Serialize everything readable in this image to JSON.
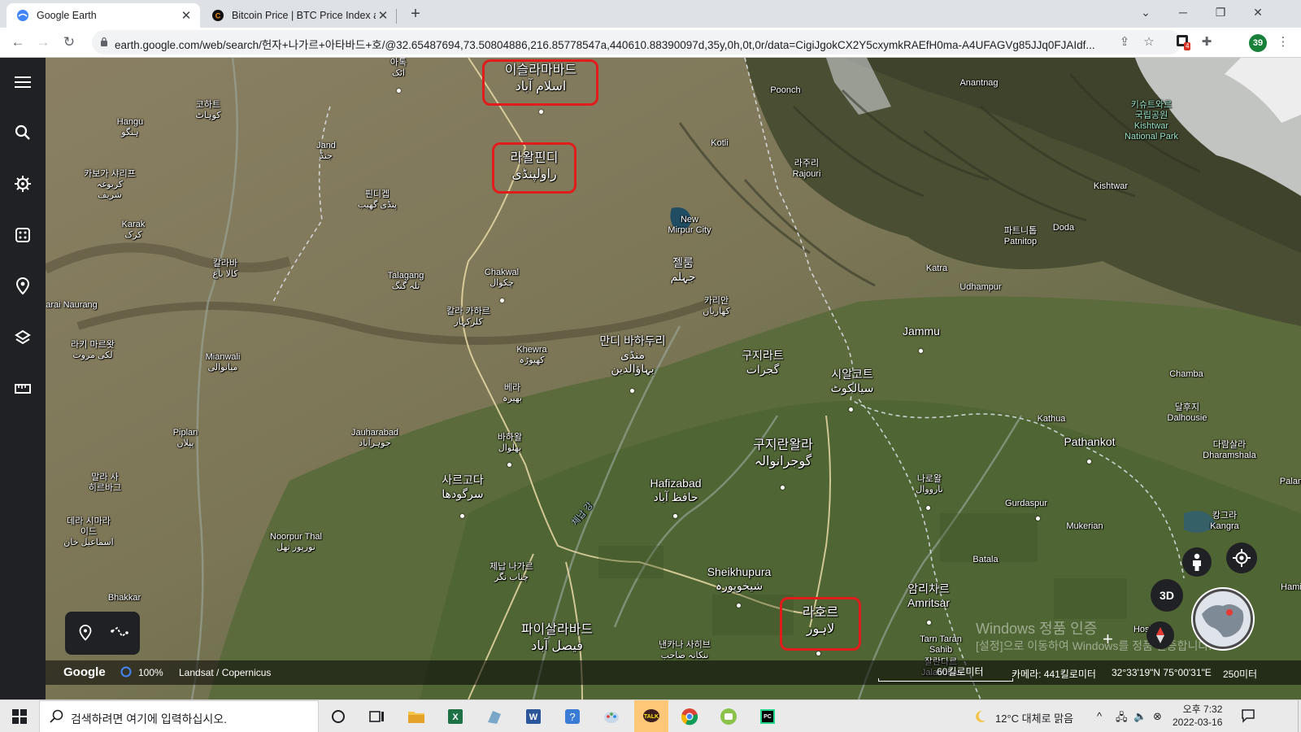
{
  "browser": {
    "tabs": [
      {
        "title": "Google Earth",
        "active": true
      },
      {
        "title": "Bitcoin Price | BTC Price Index a",
        "active": false
      }
    ],
    "url": "earth.google.com/web/search/헌자+나가르+아타바드+호/@32.65487694,73.50804886,216.85778547a,440610.88390097d,35y,0h,0t,0r/data=CigiJgokCX2Y5cxymkRAEfH0ma-A4UFAGVg85JJq0FJAIdf...",
    "extension_badge": "4",
    "profile_badge": "39"
  },
  "map": {
    "labels": {
      "islamabad_ko": "이슬라마바드",
      "islamabad_ur": "اسلام آباد",
      "rawalpindi_ko": "라왈핀디",
      "rawalpindi_ur": "راولپنڈی",
      "lahore_ko": "라호르",
      "lahore_ur": "لاہور",
      "gujranwala_ko": "구지란왈라",
      "gujranwala_ur": "گوجرانوالہ",
      "faisalabad_ko": "파이살라바드",
      "faisalabad_ur": "فیصل آباد",
      "sargodha_ko": "사르고다",
      "sargodha_ur": "سرگودھا",
      "attock_ko": "아톡",
      "attock_ur": "اٹک",
      "kohat_ko": "코하트",
      "kohat_ur": "کوہاٹ",
      "hangu_en": "Hangu",
      "hangu_ur": "ہنگو",
      "jand_en": "Jand",
      "jand_ur": "جنڈ",
      "pindigheb_ko": "핀디겝",
      "pindigheb_ur": "پنڈی گھیب",
      "karak_en": "Karak",
      "karak_ur": "کرک",
      "kalabagh_ko": "칼라바",
      "kalabagh_ur": "کالا باغ",
      "talagang_en": "Talagang",
      "talagang_ur": "تلہ گنگ",
      "chakwal_en": "Chakwal",
      "chakwal_ur": "چکوال",
      "kallarkahar_ko": "칼라 카하르",
      "kallarkahar_ur": "کلرکہار",
      "khewra_en": "Khewra",
      "khewra_ur": "کھیوڑہ",
      "mandi_ko": "만디 바하두리",
      "mandi_ur": "منڈی",
      "mandi_ur2": "بہاؤالدین",
      "jhelum_ko": "젤룸",
      "jhelum_ur": "جہلم",
      "kharian_ko": "카리안",
      "kharian_ur": "کھاریاں",
      "gujrat_ko": "구지라트",
      "gujrat_ur": "گجرات",
      "sialkot_ko": "시알코트",
      "sialkot_ur": "سیالکوٹ",
      "bhera_ko": "베라",
      "bhera_ur": "بھیرہ",
      "bhalwal_ko": "바하왈",
      "bhalwal_ur": "بھلوال",
      "jauharabad_en": "Jauharabad",
      "jauharabad_ur": "جوہرآباد",
      "mianwali_en": "Mianwali",
      "mianwali_ur": "میانوالی",
      "piplan_en": "Piplan",
      "piplan_ur": "پپلاں",
      "isakhel_ko": "이사 켈",
      "isakhel_ur": "عیسیٰ خیل",
      "lakkimarwat_ko": "라키 마르왓",
      "lakkimarwat_ur": "لکی مروت",
      "naurang_en": "arai Naurang",
      "karbogha_ko": "카보가 샤리프",
      "karbogha_ur": "کربوغہ",
      "karbogha_ur2": "شریف",
      "darya_ko": "말라 사",
      "darya_ko2": "히르바그",
      "dera_ko": "데라 시마라",
      "dera_ko2": "이드",
      "dera_ur": "اسماعیل خان",
      "noorpur_en": "Noorpur Thal",
      "noorpur_ur": "نورپور تھل",
      "bhakkar_en": "Bhakkar",
      "hafizabad_en": "Hafizabad",
      "hafizabad_ur": "حافظ آباد",
      "chiniot_ko": "제납 나가르",
      "chiniot_ur": "چناب نگر",
      "sheikhupura_en": "Sheikhupura",
      "sheikhupura_ur": "شیخوپورہ",
      "nankana_ko": "낸카나 사히브",
      "nankana_ur": "ننکانہ صاحب",
      "narowal_ko": "나로왈",
      "narowal_ur": "نارووال",
      "amritsar_ko": "암리차르",
      "amritsar_en": "Amritsar",
      "tarntaran_en": "Tarn Taran",
      "tarntaran_en2": "Sahib",
      "jalandhar_ko": "잘란다르",
      "jalandhar_en": "Jalandhar",
      "batala_en": "Batala",
      "gurdaspur_en": "Gurdaspur",
      "mukerian_en": "Mukerian",
      "pathankot_en": "Pathankot",
      "kathua_en": "Kathua",
      "jammu_en": "Jammu",
      "udhampur_en": "Udhampur",
      "katra_en": "Katra",
      "patnitop_ko": "파트니톱",
      "patnitop_en": "Patnitop",
      "doda_en": "Doda",
      "kishtwar_en": "Kishtwar",
      "kishtwar_np_ko": "키슈트와르",
      "kishtwar_np_ko2": "국립공원",
      "kishtwar_np_en": "Kishtwar",
      "kishtwar_np_en2": "National Park",
      "anantnag_en": "Anantnag",
      "poonch_en": "Poonch",
      "kotli_en": "Kotli",
      "rajouri_ko": "라주리",
      "rajouri_en": "Rajouri",
      "newmirpur_en": "New",
      "newmirpur_en2": "Mirpur City",
      "chamba_en": "Chamba",
      "dalhousie_ko": "달후지",
      "dalhousie_en": "Dalhousie",
      "dharamshala_ko": "다람살라",
      "dharamshala_en": "Dharamshala",
      "kangra_ko": "캉그라",
      "kangra_en": "Kangra",
      "palam_en": "Palan",
      "hamirpur_en": "Hami",
      "hoshiarpur_en": "Hoshi",
      "chenab_ko": "체납 강"
    },
    "watermark_1": "Windows 정품 인증",
    "watermark_2": "[설정]으로 이동하여 Windows를 정품 인증합니다.",
    "view_3d": "3D",
    "status": {
      "brand": "Google",
      "loading": "100%",
      "imagery": "Landsat / Copernicus",
      "scale": "60킬로미터",
      "camera": "카메라: 441킬로미터",
      "coords": "32°33'19\"N 75°00'31\"E",
      "elevation": "250미터"
    }
  },
  "taskbar": {
    "search_placeholder": "검색하려면 여기에 입력하십시오.",
    "weather": "12°C  대체로 맑음",
    "time": "오후 7:32",
    "date": "2022-03-16"
  }
}
